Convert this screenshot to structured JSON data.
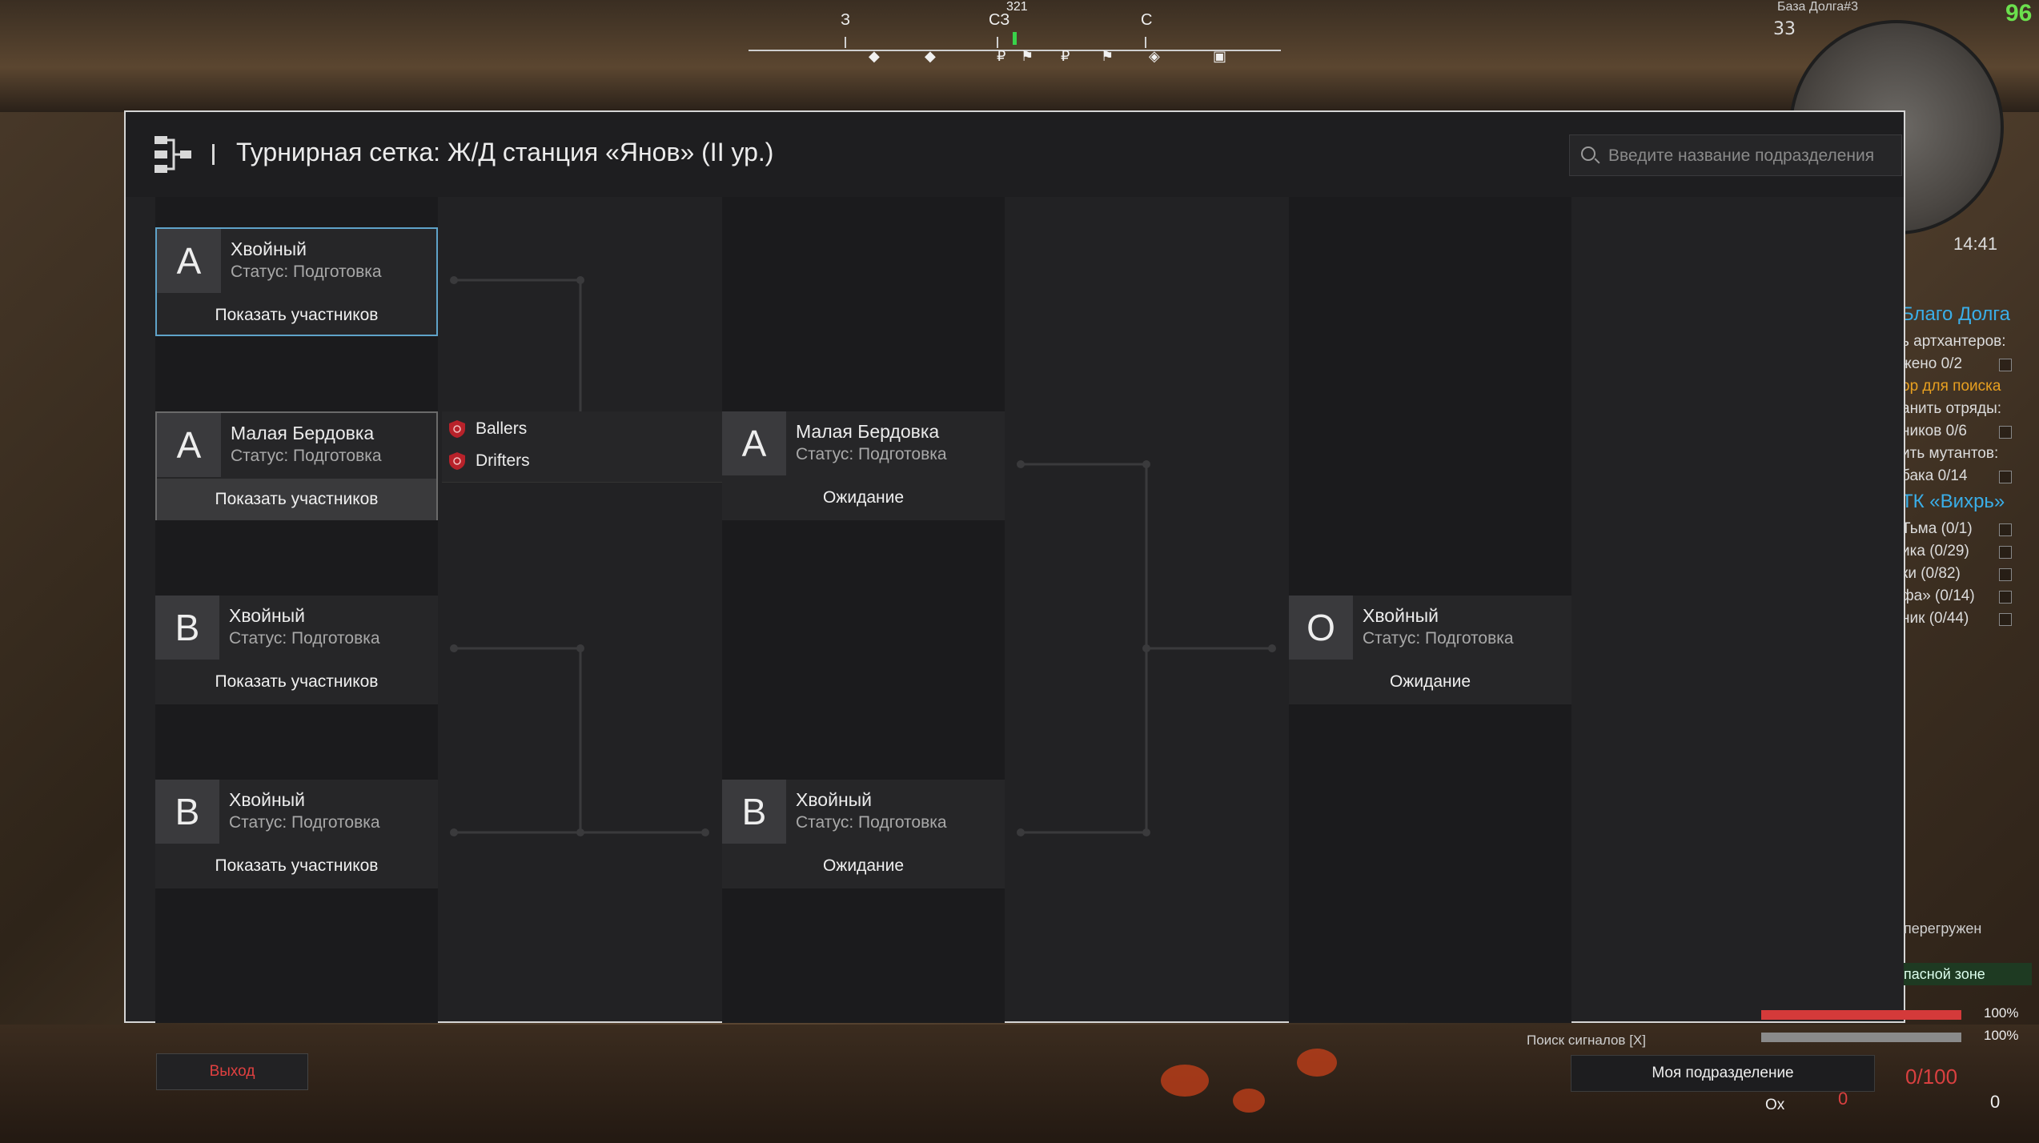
{
  "hud": {
    "compass": {
      "heading": "321",
      "labels": [
        {
          "text": "З",
          "pos": 0
        },
        {
          "text": "СЗ",
          "pos": 1
        },
        {
          "text": "С",
          "pos": 2
        }
      ]
    },
    "map_title": "База Долга#3",
    "map_zoom": "33",
    "fps": "96",
    "clock": "14:41",
    "quests": [
      {
        "title": "Благо Долга",
        "items": [
          {
            "text": "ь артхантеров:",
            "checkbox": false,
            "highlight": false
          },
          {
            "text": "жено 0/2",
            "checkbox": true,
            "highlight": false
          },
          {
            "text": "ор для поиска",
            "checkbox": false,
            "highlight": true
          },
          {
            "text": "анить отряды:",
            "checkbox": false,
            "highlight": false
          },
          {
            "text": "ников 0/6",
            "checkbox": true,
            "highlight": false
          },
          {
            "text": "ить мутантов:",
            "checkbox": false,
            "highlight": false
          },
          {
            "text": "бака 0/14",
            "checkbox": true,
            "highlight": false
          }
        ]
      },
      {
        "title": "ТК «Вихрь»",
        "items": [
          {
            "text": "Тьма (0/1)",
            "checkbox": true,
            "highlight": false
          },
          {
            "text": "ика (0/29)",
            "checkbox": true,
            "highlight": false
          },
          {
            "text": "ки (0/82)",
            "checkbox": true,
            "highlight": false
          },
          {
            "text": "фа» (0/14)",
            "checkbox": true,
            "highlight": false
          },
          {
            "text": "ник (0/44)",
            "checkbox": true,
            "highlight": false
          }
        ]
      }
    ],
    "overload": "перегружен",
    "danger_zone": "пасной зоне",
    "health_pct": "100%",
    "stamina_pct": "100%",
    "signal_search": "Поиск сигналов [X]",
    "my_group": "Моя подразделение",
    "ammo": "0/100",
    "left_count": "0",
    "right_count": "0",
    "ox": "Ox",
    "exit": "Выход",
    "colors": {
      "health": "#d43a3a",
      "stamina": "#8a8a8a",
      "fps": "#6be04d",
      "quest_title": "#3aaee8"
    }
  },
  "panel": {
    "title": "Турнирная сетка: Ж/Д станция «Янов» (II ур.)",
    "search_placeholder": "Введите название подразделения",
    "round1": [
      {
        "letter": "А",
        "name": "Хвойный",
        "status": "Статус: Подготовка",
        "action": "Показать участников"
      },
      {
        "letter": "А",
        "name": "Малая Бердовка",
        "status": "Статус: Подготовка",
        "action": "Показать участников"
      },
      {
        "letter": "В",
        "name": "Хвойный",
        "status": "Статус: Подготовка",
        "action": "Показать участников"
      },
      {
        "letter": "В",
        "name": "Хвойный",
        "status": "Статус: Подготовка",
        "action": "Показать участников"
      }
    ],
    "teams_popup": [
      "Ballers",
      "Drifters"
    ],
    "round2": [
      {
        "letter": "А",
        "name": "Малая Бердовка",
        "status": "Статус: Подготовка",
        "action": "Ожидание"
      },
      {
        "letter": "В",
        "name": "Хвойный",
        "status": "Статус: Подготовка",
        "action": "Ожидание"
      }
    ],
    "final": {
      "letter": "О",
      "name": "Хвойный",
      "status": "Статус: Подготовка",
      "action": "Ожидание"
    }
  }
}
